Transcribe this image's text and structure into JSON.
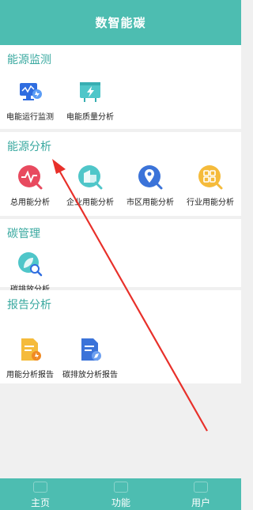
{
  "header": {
    "title": "数智能碳"
  },
  "sections": {
    "energy_monitor": {
      "title": "能源监测",
      "items": [
        {
          "label": "电能运行监测",
          "icon": "monitor-icon"
        },
        {
          "label": "电能质量分析",
          "icon": "power-board-icon"
        }
      ]
    },
    "energy_analysis": {
      "title": "能源分析",
      "items": [
        {
          "label": "总用能分析",
          "icon": "pulse-icon"
        },
        {
          "label": "企业用能分析",
          "icon": "building-icon"
        },
        {
          "label": "市区用能分析",
          "icon": "location-icon"
        },
        {
          "label": "行业用能分析",
          "icon": "grid-icon"
        }
      ]
    },
    "carbon_mgmt": {
      "title": "碳管理",
      "items": [
        {
          "label": "碳排放分析",
          "icon": "leaf-search-icon"
        }
      ]
    },
    "report": {
      "title": "报告分析",
      "items": [
        {
          "label": "用能分析报告",
          "icon": "report-icon"
        },
        {
          "label": "碳排放分析报告",
          "icon": "doc-compass-icon"
        }
      ]
    }
  },
  "tabbar": {
    "tabs": [
      {
        "label": "主页"
      },
      {
        "label": "功能"
      },
      {
        "label": "用户"
      }
    ]
  },
  "colors": {
    "primary": "#4dbdb1",
    "section_title": "#3aa9a0",
    "annotation_arrow": "#e8302a"
  }
}
